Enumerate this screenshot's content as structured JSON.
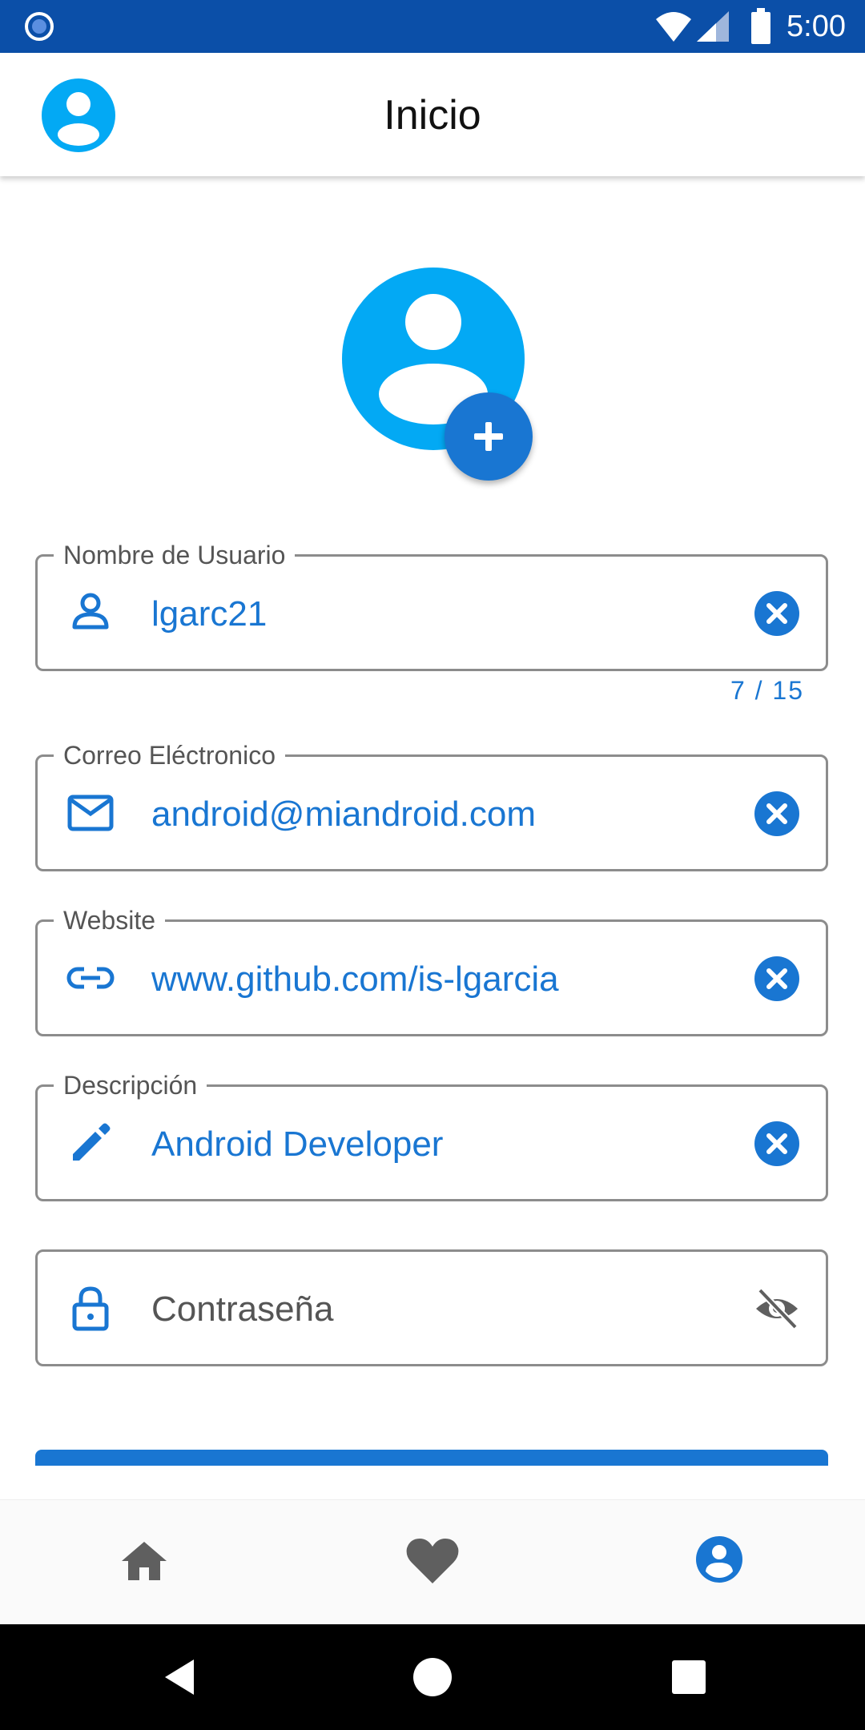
{
  "status_bar": {
    "time": "5:00"
  },
  "app_bar": {
    "title": "Inicio"
  },
  "form": {
    "username": {
      "label": "Nombre de Usuario",
      "value": "lgarc21",
      "counter": "7 / 15"
    },
    "email": {
      "label": "Correo Eléctronico",
      "value": "android@miandroid.com"
    },
    "website": {
      "label": "Website",
      "value": "www.github.com/is-lgarcia"
    },
    "description": {
      "label": "Descripción",
      "value": "Android Developer"
    },
    "password": {
      "placeholder": "Contraseña"
    }
  },
  "icons": {
    "account": "account-circle-icon",
    "add_photo": "plus-icon",
    "person": "person-outline-icon",
    "email": "mail-outline-icon",
    "link": "link-icon",
    "edit": "pencil-icon",
    "lock": "lock-outline-icon",
    "clear": "clear-circle-icon",
    "visibility_off": "eye-off-icon",
    "home": "home-icon",
    "favorite": "heart-icon",
    "profile": "account-circle-icon"
  },
  "colors": {
    "status_bar": "#0b4fa8",
    "primary": "#1976d2",
    "avatar": "#03a9f4",
    "outline": "#8c8c8c",
    "nav_inactive": "#5f5f5f"
  },
  "bottom_nav": {
    "selected": "profile"
  }
}
